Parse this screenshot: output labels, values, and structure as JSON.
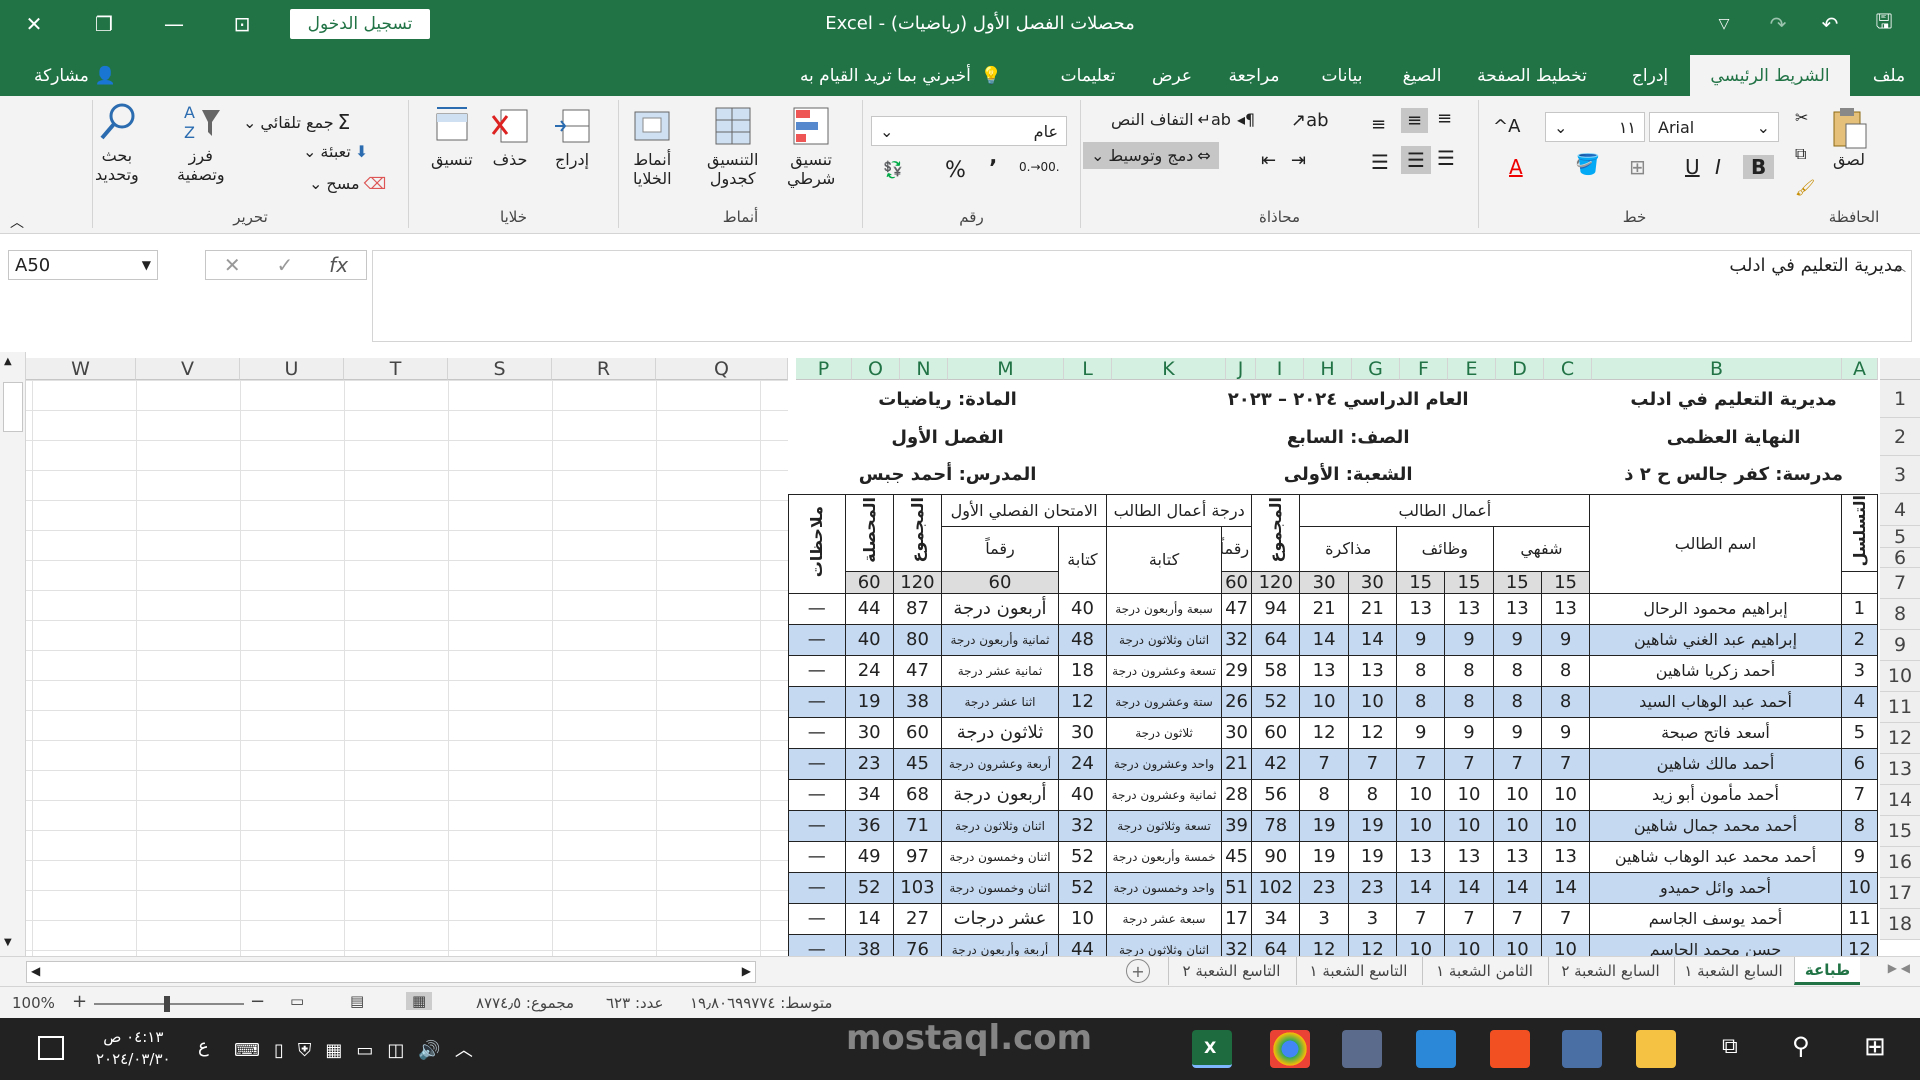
{
  "titlebar": {
    "title": "محصلات الفصل الأول (رياضيات)  -  Excel",
    "signin": "تسجيل الدخول"
  },
  "tabs": {
    "file": "ملف",
    "home": "الشريط الرئيسي",
    "insert": "إدراج",
    "page_layout": "تخطيط الصفحة",
    "formulas": "الصيغ",
    "data": "بيانات",
    "review": "مراجعة",
    "view": "عرض",
    "help": "تعليمات",
    "tell_me": "أخبرني بما تريد القيام به",
    "share": "مشاركة"
  },
  "ribbon": {
    "clipboard": {
      "label": "الحافظة",
      "paste": "لصق"
    },
    "font": {
      "label": "خط",
      "name": "Arial",
      "size": "١١"
    },
    "alignment": {
      "label": "محاذاة",
      "wrap": "التفاف النص",
      "merge": "دمج وتوسيط"
    },
    "number": {
      "label": "رقم",
      "format": "عام",
      "percent": "%",
      "comma": "٬"
    },
    "styles": {
      "label": "أنماط",
      "conditional1": "تنسيق",
      "conditional2": "شرطي",
      "table1": "التنسيق",
      "table2": "كجدول",
      "cell1": "أنماط",
      "cell2": "الخلايا"
    },
    "cells": {
      "label": "خلايا",
      "insert": "إدراج",
      "delete": "حذف",
      "format": "تنسيق"
    },
    "editing": {
      "label": "تحرير",
      "autosum": "جمع تلقائي",
      "fill": "تعبئة",
      "clear": "مسح",
      "sort1": "فرز",
      "sort2": "وتصفية",
      "find1": "بحث",
      "find2": "وتحديد"
    }
  },
  "formula_bar": {
    "name_box": "A50",
    "content": "مديرية التعليم في ادلب"
  },
  "columns_empty": [
    "W",
    "V",
    "U",
    "T",
    "S",
    "R",
    "Q"
  ],
  "columns_sheet": [
    "P",
    "O",
    "N",
    "M",
    "L",
    "K",
    "J",
    "I",
    "H",
    "G",
    "F",
    "E",
    "D",
    "C",
    "B",
    "A"
  ],
  "rows": [
    "1",
    "2",
    "3",
    "4",
    "5",
    "6",
    "7",
    "8",
    "9",
    "10",
    "11",
    "12",
    "13",
    "14",
    "15",
    "16",
    "17",
    "18"
  ],
  "header": {
    "directorate": "مديرية التعليم في ادلب",
    "school_year": "العام الدراسي ٢٠٢٤ – ٢٠٢٣",
    "subject": "المادة: رياضيات",
    "area": "النهاية العظمى",
    "grade": "الصف: السابع",
    "term": "الفصل الأول",
    "school": "مدرسة: كفر جالس ح ٢ ذ",
    "section": "الشعبة: الأولى",
    "teacher": "المدرس: أحمد جبس"
  },
  "table_head": {
    "serial": "التسلسل",
    "name": "اسم الطالب",
    "works": "أعمال الطالب",
    "oral": "شفهي",
    "homework": "وظائف",
    "study": "مذاكرة",
    "total": "المجموع",
    "work_grade": "درجة أعمال الطالب",
    "numeric": "رقماً",
    "written": "كتابة",
    "exam": "الامتحان الفصلي الأول",
    "total2": "المجموع",
    "result": "المحصلة",
    "notes": "ملاحظات",
    "max": {
      "oral1": "15",
      "oral2": "15",
      "hw1": "15",
      "hw2": "15",
      "st1": "30",
      "st2": "30",
      "total": "120",
      "wg": "60",
      "ex": "60",
      "total2": "120",
      "result": "60"
    }
  },
  "students": [
    {
      "n": "1",
      "name": "إبراهيم محمود الرحال",
      "c": "13",
      "d": "13",
      "e": "13",
      "f": "13",
      "g": "21",
      "h": "21",
      "i": "94",
      "j": "47",
      "k": "سبعة وأربعون درجة",
      "l": "40",
      "m": "أربعون درجة",
      "nn": "87",
      "o": "44",
      "p": "—"
    },
    {
      "n": "2",
      "name": "إبراهيم عبد الغني شاهين",
      "c": "9",
      "d": "9",
      "e": "9",
      "f": "9",
      "g": "14",
      "h": "14",
      "i": "64",
      "j": "32",
      "k": "اثنان وثلاثون درجة",
      "l": "48",
      "m": "ثمانية وأربعون درجة",
      "nn": "80",
      "o": "40",
      "p": "—"
    },
    {
      "n": "3",
      "name": "أحمد زكريا شاهين",
      "c": "8",
      "d": "8",
      "e": "8",
      "f": "8",
      "g": "13",
      "h": "13",
      "i": "58",
      "j": "29",
      "k": "تسعة وعشرون درجة",
      "l": "18",
      "m": "ثمانية عشر درجة",
      "nn": "47",
      "o": "24",
      "p": "—"
    },
    {
      "n": "4",
      "name": "أحمد عبد الوهاب السيد",
      "c": "8",
      "d": "8",
      "e": "8",
      "f": "8",
      "g": "10",
      "h": "10",
      "i": "52",
      "j": "26",
      "k": "ستة وعشرون درجة",
      "l": "12",
      "m": "اثنا عشر درجة",
      "nn": "38",
      "o": "19",
      "p": "—"
    },
    {
      "n": "5",
      "name": "أسعد فاتح صبحة",
      "c": "9",
      "d": "9",
      "e": "9",
      "f": "9",
      "g": "12",
      "h": "12",
      "i": "60",
      "j": "30",
      "k": "ثلاثون درجة",
      "l": "30",
      "m": "ثلاثون درجة",
      "nn": "60",
      "o": "30",
      "p": "—"
    },
    {
      "n": "6",
      "name": "أحمد مالك شاهين",
      "c": "7",
      "d": "7",
      "e": "7",
      "f": "7",
      "g": "7",
      "h": "7",
      "i": "42",
      "j": "21",
      "k": "واحد وعشرون درجة",
      "l": "24",
      "m": "أربعة وعشرون درجة",
      "nn": "45",
      "o": "23",
      "p": "—"
    },
    {
      "n": "7",
      "name": "أحمد مأمون أبو زيد",
      "c": "10",
      "d": "10",
      "e": "10",
      "f": "10",
      "g": "8",
      "h": "8",
      "i": "56",
      "j": "28",
      "k": "ثمانية وعشرون درجة",
      "l": "40",
      "m": "أربعون درجة",
      "nn": "68",
      "o": "34",
      "p": "—"
    },
    {
      "n": "8",
      "name": "أحمد محمد جمال شاهين",
      "c": "10",
      "d": "10",
      "e": "10",
      "f": "10",
      "g": "19",
      "h": "19",
      "i": "78",
      "j": "39",
      "k": "تسعة وثلاثون درجة",
      "l": "32",
      "m": "اثنان وثلاثون درجة",
      "nn": "71",
      "o": "36",
      "p": "—"
    },
    {
      "n": "9",
      "name": "أحمد محمد عبد الوهاب شاهين",
      "c": "13",
      "d": "13",
      "e": "13",
      "f": "13",
      "g": "19",
      "h": "19",
      "i": "90",
      "j": "45",
      "k": "خمسة وأربعون درجة",
      "l": "52",
      "m": "اثنان وخمسون درجة",
      "nn": "97",
      "o": "49",
      "p": "—"
    },
    {
      "n": "10",
      "name": "أحمد وائل حميدو",
      "c": "14",
      "d": "14",
      "e": "14",
      "f": "14",
      "g": "23",
      "h": "23",
      "i": "102",
      "j": "51",
      "k": "واحد وخمسون درجة",
      "l": "52",
      "m": "اثنان وخمسون درجة",
      "nn": "103",
      "o": "52",
      "p": "—"
    },
    {
      "n": "11",
      "name": "أحمد يوسف الجاسم",
      "c": "7",
      "d": "7",
      "e": "7",
      "f": "7",
      "g": "3",
      "h": "3",
      "i": "34",
      "j": "17",
      "k": "سبعة عشر درجة",
      "l": "10",
      "m": "عشر درجات",
      "nn": "27",
      "o": "14",
      "p": "—"
    },
    {
      "n": "12",
      "name": "حسن محمد الجاسم",
      "c": "10",
      "d": "10",
      "e": "10",
      "f": "10",
      "g": "12",
      "h": "12",
      "i": "64",
      "j": "32",
      "k": "اثنان وثلاثون درجة",
      "l": "44",
      "m": "أربعة وأربعون درجة",
      "nn": "76",
      "o": "38",
      "p": "—"
    }
  ],
  "sheet_tabs": [
    "طباعة",
    "السابع الشعبة ١",
    "السابع الشعبة ٢",
    "الثامن الشعبة ١",
    "التاسع الشعبة ١",
    "التاسع الشعبة ٢"
  ],
  "status": {
    "zoom": "100%",
    "average": "متوسط: ١٩٫٨٠٦٩٩٧٧٤",
    "count": "عدد: ٦٢٣",
    "sum": "مجموع: ٨٧٧٤٫٥"
  },
  "taskbar": {
    "time": "٠٤:١٣ ص",
    "date": "٢٠٢٤/٠٣/٣٠",
    "lang": "ع"
  },
  "watermark": "mostaql.com",
  "colors": {
    "excel_green": "#217346",
    "row_blue": "#c5d9f1"
  }
}
